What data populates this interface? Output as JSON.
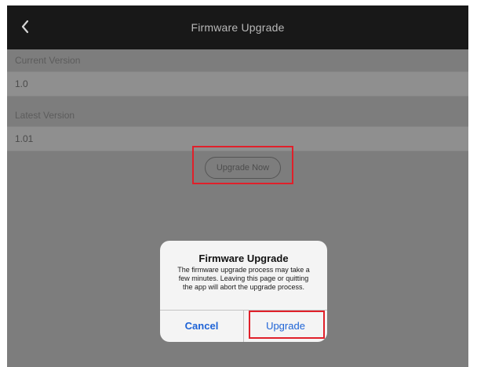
{
  "header": {
    "back_icon": "chevron-left-icon",
    "title": "Firmware Upgrade"
  },
  "current_version": {
    "label": "Current Version",
    "value": "1.0"
  },
  "latest_version": {
    "label": "Latest Version",
    "value": "1.01"
  },
  "upgrade_now_label": "Upgrade Now",
  "dialog": {
    "title": "Firmware Upgrade",
    "message": "The firmware upgrade process may take a few minutes. Leaving this page or quitting the app will abort the upgrade process.",
    "cancel_label": "Cancel",
    "confirm_label": "Upgrade"
  },
  "colors": {
    "nav_bar": "#181818",
    "overlay_background": "#7d7d7d",
    "dialog_button": "#1e63d6",
    "highlight": "#e0202a"
  }
}
